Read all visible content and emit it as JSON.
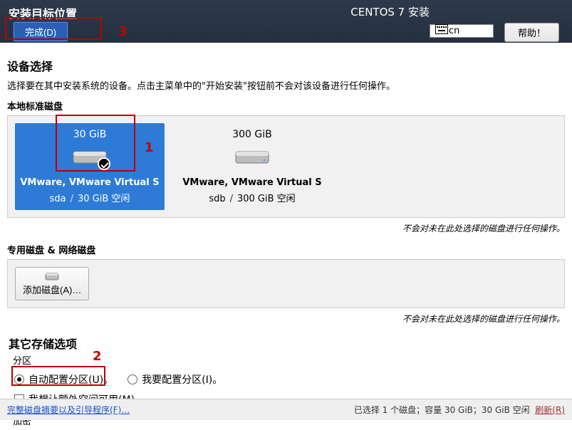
{
  "top": {
    "title": "安装目标位置",
    "done_label": "完成(D)",
    "release": "CENTOS 7 安装",
    "keyboard": "cn",
    "help_label": "帮助！"
  },
  "device_selection": {
    "heading": "设备选择",
    "instruction": "选择要在其中安装系统的设备。点击主菜单中的\"开始安装\"按钮前不会对该设备进行任何操作。",
    "local_heading": "本地标准磁盘"
  },
  "disks": [
    {
      "size": "30 GiB",
      "name": "VMware, VMware Virtual S",
      "dev": "sda",
      "free": "30 GiB 空闲",
      "selected": true
    },
    {
      "size": "300 GiB",
      "name": "VMware, VMware Virtual S",
      "dev": "sdb",
      "free": "300 GiB 空闲",
      "selected": false
    }
  ],
  "notes": {
    "unsel1": "不会对未在此处选择的磁盘进行任何操作。",
    "unsel2": "不会对未在此处选择的磁盘进行任何操作。"
  },
  "special": {
    "heading": "专用磁盘 & 网络磁盘",
    "add_label": "添加磁盘(A)…"
  },
  "storage": {
    "heading": "其它存储选项",
    "part_label": "分区",
    "auto_label": "自动配置分区(U)。",
    "manual_label": "我要配置分区(I)。",
    "freespace_label": "我想让额外空间可用(M)。",
    "enc_label": "加密"
  },
  "bottom": {
    "summary_link": "完整磁盘摘要以及引导程序(F)…",
    "status_prefix": "已选择 1 个磁盘；容量 30 GiB；30 GiB 空闲",
    "refresh": "刷新(R)"
  },
  "annotations": {
    "a1": "1",
    "a2": "2",
    "a3": "3"
  }
}
